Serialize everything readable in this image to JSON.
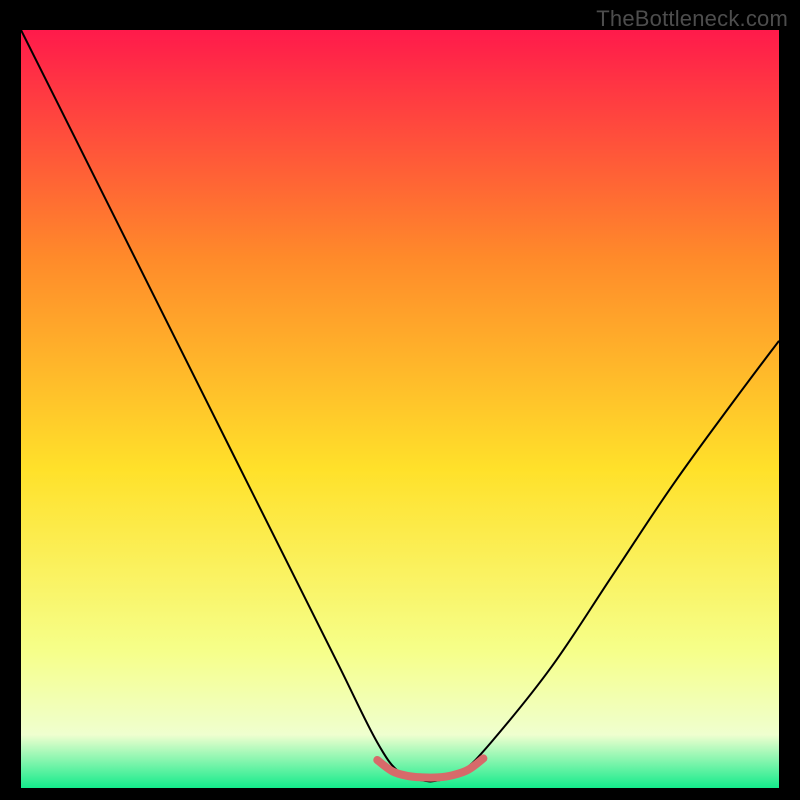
{
  "watermark": "TheBottleneck.com",
  "chart_data": {
    "type": "line",
    "title": "",
    "xlabel": "",
    "ylabel": "",
    "xlim": [
      0,
      100
    ],
    "ylim": [
      0,
      100
    ],
    "grid": false,
    "background_gradient": {
      "top": "#ff1a4b",
      "upper_mid": "#ff8a2a",
      "mid": "#ffe12a",
      "lower_mid": "#f6ff8a",
      "band": "#efffcf",
      "bottom": "#14eb8b"
    },
    "series": [
      {
        "name": "bottleneck-curve",
        "x": [
          0,
          7,
          14,
          21,
          28,
          35,
          42,
          47,
          50,
          53,
          55,
          58,
          62,
          70,
          78,
          86,
          94,
          100
        ],
        "y": [
          100,
          86,
          72,
          58,
          44,
          30,
          16,
          6,
          2,
          1,
          1,
          2,
          6,
          16,
          28,
          40,
          51,
          59
        ],
        "color": "#000000",
        "stroke_width": 2
      },
      {
        "name": "optimal-zone",
        "x": [
          47,
          49,
          51,
          53,
          55,
          57,
          59,
          61
        ],
        "y": [
          3.7,
          2.2,
          1.6,
          1.4,
          1.4,
          1.7,
          2.4,
          3.9
        ],
        "color": "#d76a6a",
        "stroke_width": 8
      }
    ]
  }
}
